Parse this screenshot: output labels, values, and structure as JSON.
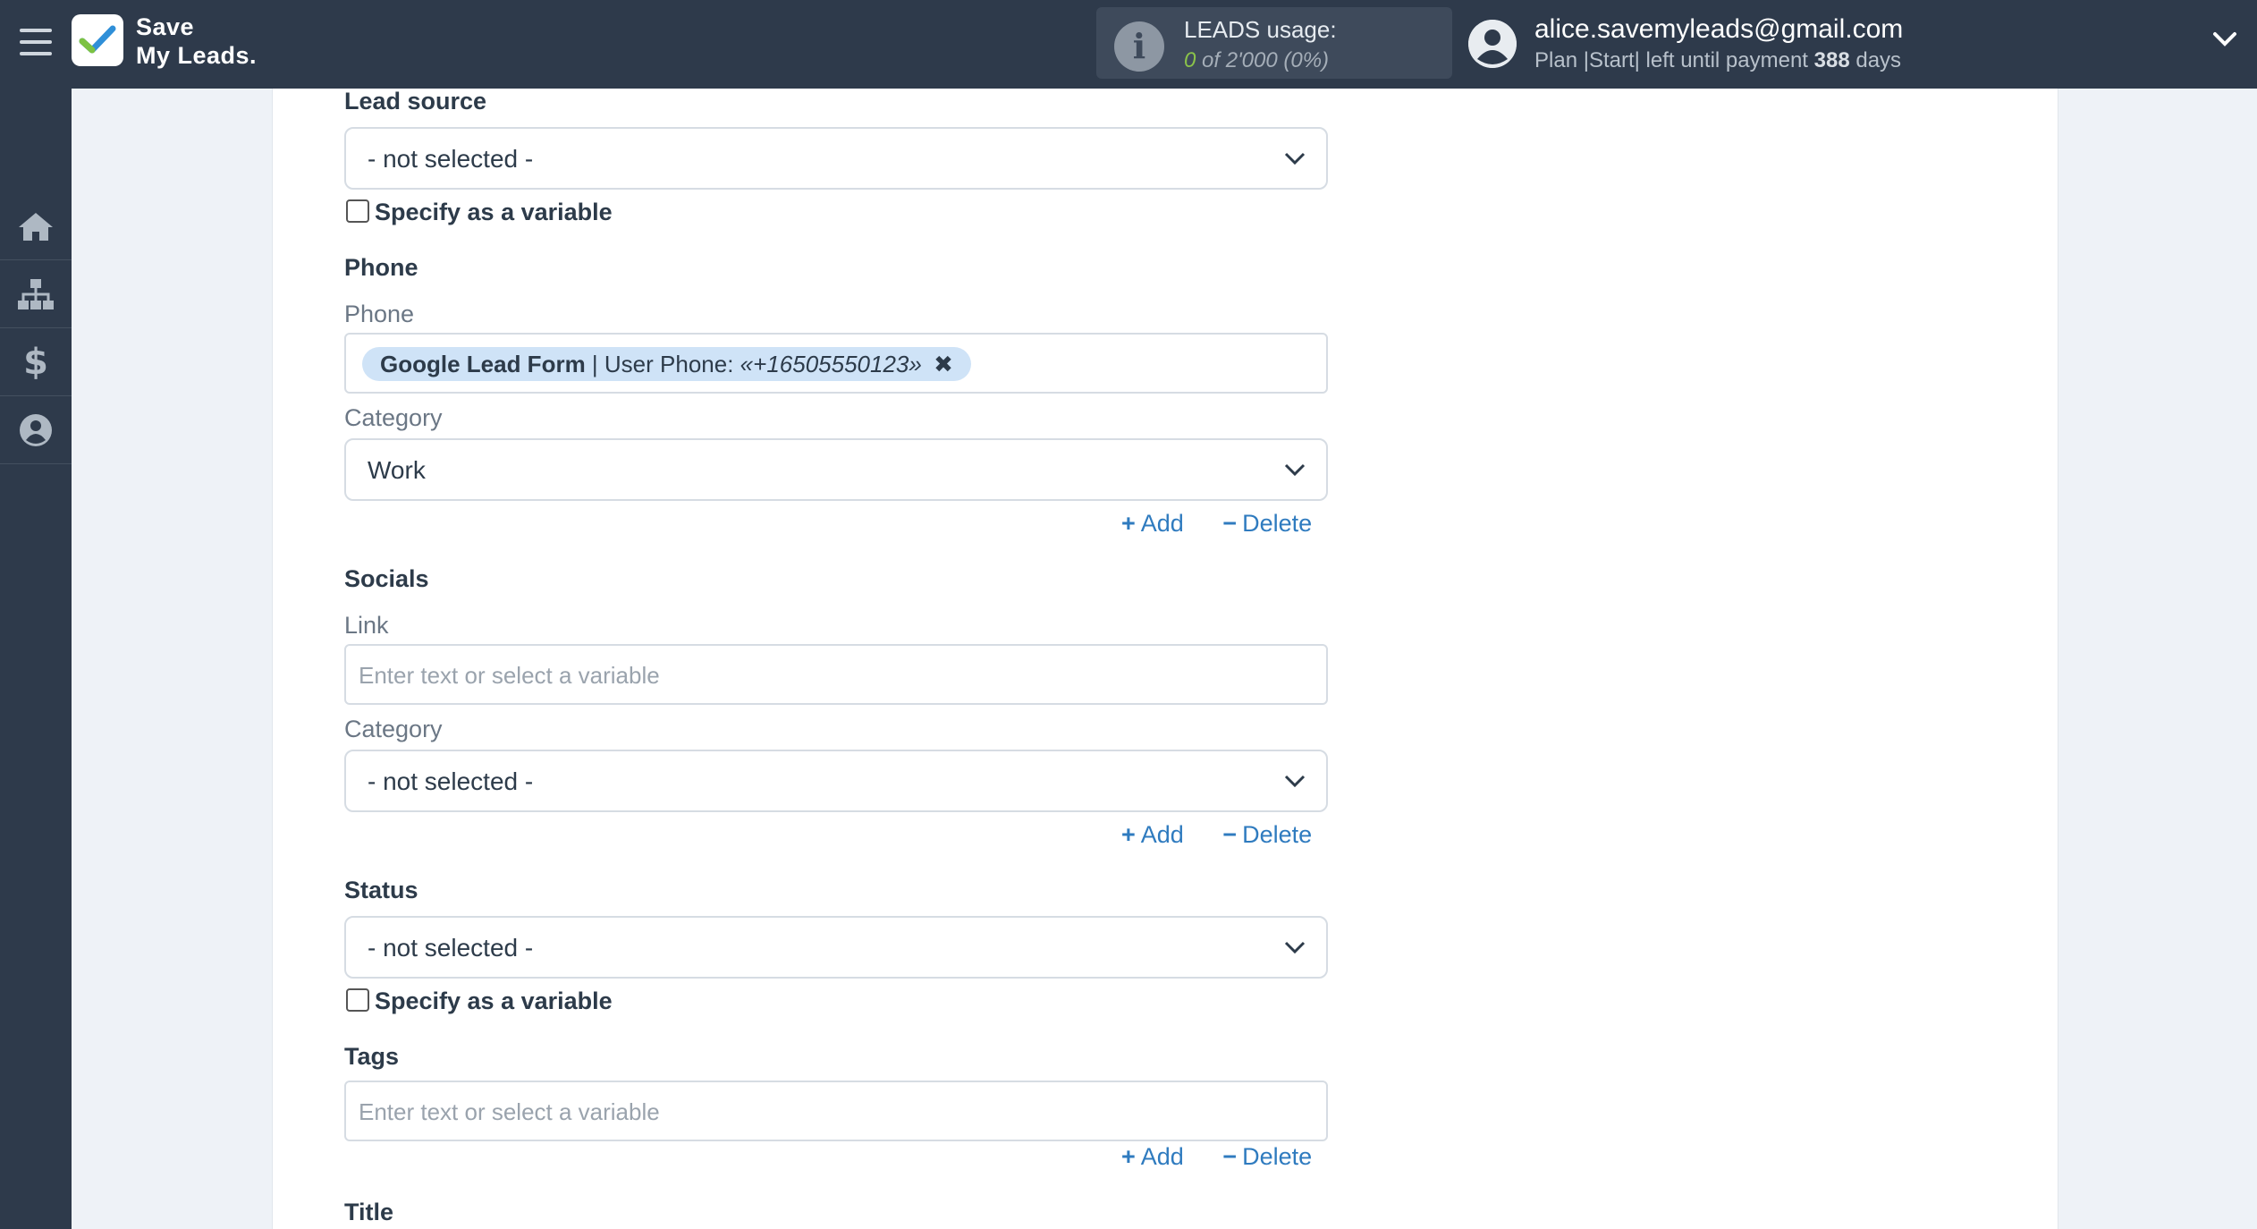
{
  "brand": {
    "line1": "Save",
    "line2": "My Leads."
  },
  "usage": {
    "title": "LEADS usage:",
    "used": "0",
    "of_total": "of 2'000",
    "percent": "(0%)"
  },
  "account": {
    "email": "alice.savemyleads@gmail.com",
    "plan_prefix": "Plan |Start| left until payment",
    "days": "388",
    "days_suffix": "days"
  },
  "sidebar": {
    "items": [
      "home-icon",
      "sitemap-icon",
      "dollar-icon",
      "user-icon"
    ]
  },
  "form": {
    "lead_source": {
      "label": "Lead source",
      "value": "- not selected -",
      "checkbox": "Specify as a variable"
    },
    "phone": {
      "section": "Phone",
      "field_label": "Phone",
      "tag_source": "Google Lead Form",
      "tag_field": "| User Phone:",
      "tag_value": "«+16505550123»",
      "tag_remove": "✖",
      "category_label": "Category",
      "category_value": "Work",
      "add": "Add",
      "delete": "Delete"
    },
    "socials": {
      "section": "Socials",
      "link_label": "Link",
      "link_placeholder": "Enter text or select a variable",
      "category_label": "Category",
      "category_value": "- not selected -",
      "add": "Add",
      "delete": "Delete"
    },
    "status": {
      "label": "Status",
      "value": "- not selected -",
      "checkbox": "Specify as a variable"
    },
    "tags": {
      "label": "Tags",
      "placeholder": "Enter text or select a variable",
      "add": "Add",
      "delete": "Delete"
    },
    "title": {
      "label": "Title"
    }
  },
  "colors": {
    "topbar": "#2e3a4b",
    "link": "#2f7bbf",
    "tag_bg": "#cfe3f7",
    "accent_green": "#8bc34a"
  }
}
